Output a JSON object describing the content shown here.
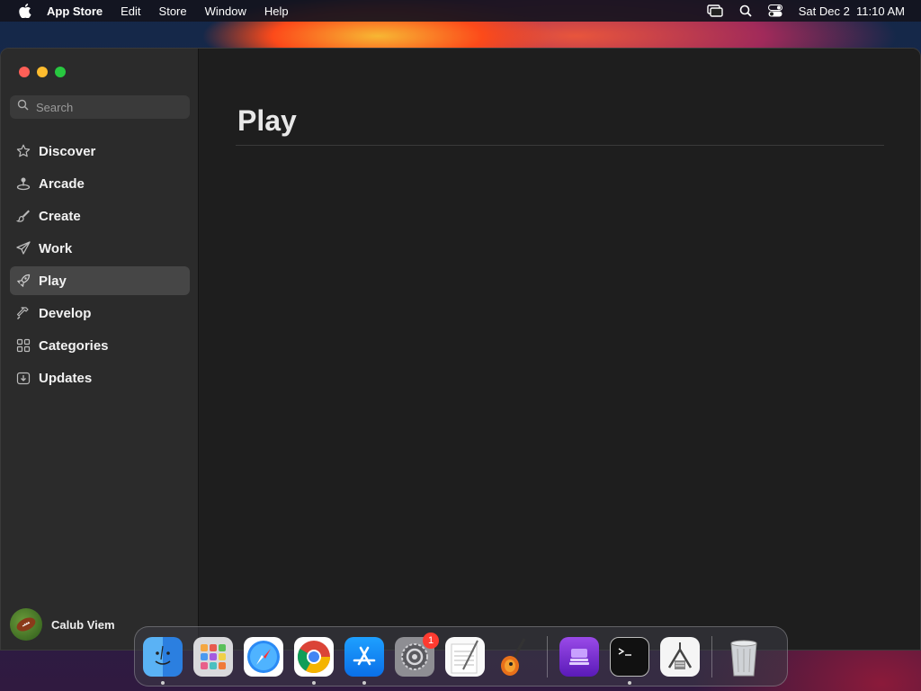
{
  "menubar": {
    "app_name": "App Store",
    "items": [
      "Edit",
      "Store",
      "Window",
      "Help"
    ],
    "datetime": "Sat Dec 2  11:10 AM"
  },
  "sidebar": {
    "search_placeholder": "Search",
    "items": [
      {
        "label": "Discover",
        "icon": "star-icon"
      },
      {
        "label": "Arcade",
        "icon": "joystick-icon"
      },
      {
        "label": "Create",
        "icon": "brush-icon"
      },
      {
        "label": "Work",
        "icon": "paper-plane-icon"
      },
      {
        "label": "Play",
        "icon": "rocket-icon",
        "active": true
      },
      {
        "label": "Develop",
        "icon": "hammer-icon"
      },
      {
        "label": "Categories",
        "icon": "grid-icon"
      },
      {
        "label": "Updates",
        "icon": "download-icon"
      }
    ],
    "account_name": "Calub Viem"
  },
  "main": {
    "title": "Play"
  },
  "dock": {
    "apps": [
      {
        "name": "Finder",
        "icon": "finder-icon",
        "running": true
      },
      {
        "name": "Launchpad",
        "icon": "launchpad-icon",
        "running": false
      },
      {
        "name": "Safari",
        "icon": "safari-icon",
        "running": false
      },
      {
        "name": "Chrome",
        "icon": "chrome-icon",
        "running": true
      },
      {
        "name": "App Store",
        "icon": "app-store-icon",
        "running": true
      },
      {
        "name": "System Settings",
        "icon": "settings-icon",
        "running": false,
        "badge": "1"
      },
      {
        "name": "TextEdit",
        "icon": "textedit-icon",
        "running": false
      },
      {
        "name": "GarageBand",
        "icon": "guitar-icon",
        "running": false
      },
      {
        "name": "Disk Utility",
        "icon": "disk-icon",
        "running": false
      },
      {
        "name": "Terminal",
        "icon": "terminal-icon",
        "running": true
      },
      {
        "name": "Instruments",
        "icon": "calipers-icon",
        "running": false
      },
      {
        "name": "Trash",
        "icon": "trash-icon",
        "running": false
      }
    ]
  },
  "colors": {
    "accent_active": "#464646",
    "close": "#ff5f57",
    "minimize": "#febc2e",
    "maximize": "#28c840"
  }
}
